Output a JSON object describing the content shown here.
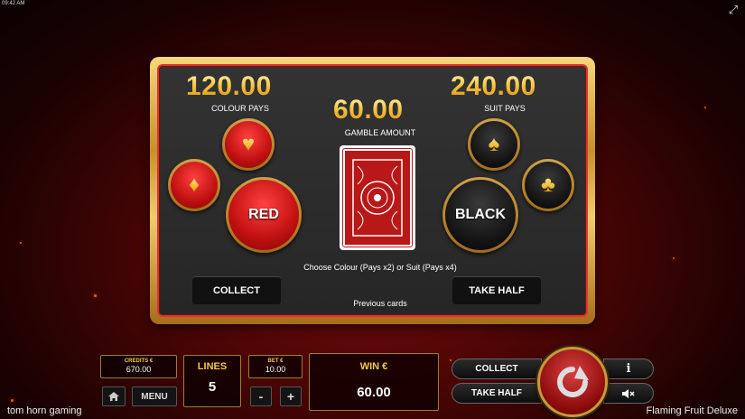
{
  "clock": "09:42 AM",
  "gamble": {
    "colour_pays_value": "120.00",
    "colour_pays_label": "COLOUR PAYS",
    "gamble_amount_value": "60.00",
    "gamble_amount_label": "GAMBLE AMOUNT",
    "suit_pays_value": "240.00",
    "suit_pays_label": "SUIT PAYS",
    "red_label": "RED",
    "black_label": "BLACK",
    "instructions": "Choose Colour (Pays x2) or Suit (Pays x4)",
    "collect_label": "COLLECT",
    "take_half_label": "TAKE HALF",
    "previous_cards_label": "Previous cards",
    "suits": {
      "hearts": "♥",
      "diamonds": "♦",
      "spades": "♠",
      "clubs": "♣"
    }
  },
  "bottom": {
    "credits_label": "CREDITS €",
    "credits_value": "670.00",
    "lines_label": "LINES",
    "lines_value": "5",
    "bet_label": "BET €",
    "bet_value": "10.00",
    "win_label": "WIN €",
    "win_value": "60.00",
    "menu_label": "MENU",
    "minus_label": "-",
    "plus_label": "+",
    "collect_label": "COLLECT",
    "take_half_label": "TAKE HALF"
  },
  "brand": "tom horn gaming",
  "game_title": "Flaming Fruit Deluxe",
  "colors": {
    "gold": "#f3c94b",
    "red": "#c01010",
    "panel": "#2a2a2a"
  }
}
